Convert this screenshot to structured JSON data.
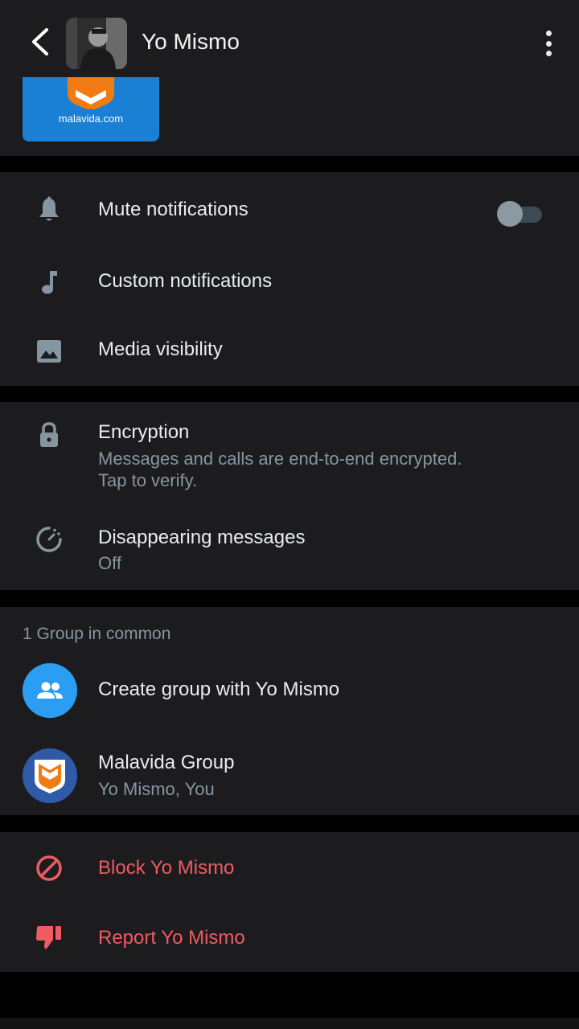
{
  "header": {
    "title": "Yo Mismo"
  },
  "media": {
    "thumb_caption": "malavida.com"
  },
  "notifications": {
    "mute_label": "Mute notifications",
    "mute_enabled": false,
    "custom_label": "Custom notifications",
    "media_visibility_label": "Media visibility"
  },
  "privacy": {
    "encryption_label": "Encryption",
    "encryption_sub_line1": "Messages and calls are end-to-end encrypted.",
    "encryption_sub_line2": "Tap to verify.",
    "disappearing_label": "Disappearing messages",
    "disappearing_value": "Off"
  },
  "groups": {
    "header": "1 Group in common",
    "create_label": "Create group with Yo Mismo",
    "items": [
      {
        "name": "Malavida Group",
        "members": "Yo Mismo, You"
      }
    ]
  },
  "actions": {
    "block_label": "Block Yo Mismo",
    "report_label": "Report Yo Mismo"
  },
  "colors": {
    "danger": "#ef5b63",
    "accent_blue": "#2b9df2",
    "secondary_text": "#8696a0"
  }
}
